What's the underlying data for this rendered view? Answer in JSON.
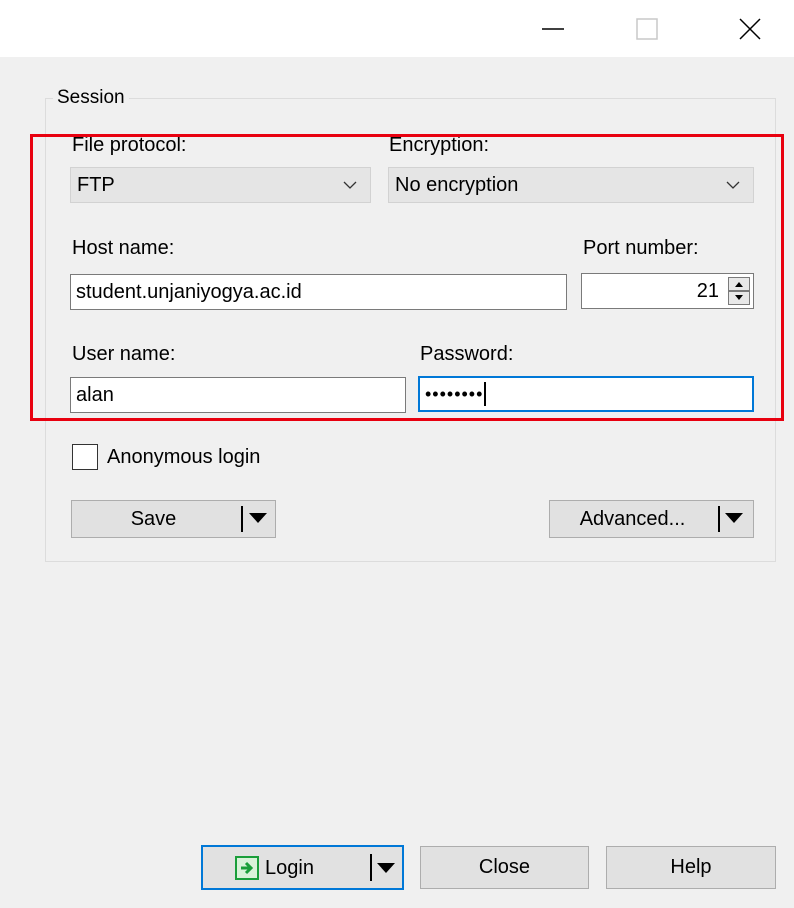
{
  "session": {
    "group_label": "Session",
    "file_protocol": {
      "label": "File protocol:",
      "value": "FTP"
    },
    "encryption": {
      "label": "Encryption:",
      "value": "No encryption"
    },
    "host": {
      "label": "Host name:",
      "value": "student.unjaniyogya.ac.id"
    },
    "port": {
      "label": "Port number:",
      "value": "21"
    },
    "user": {
      "label": "User name:",
      "value": "alan"
    },
    "password": {
      "label": "Password:",
      "value": "••••••••"
    },
    "anonymous": {
      "label": "Anonymous login",
      "checked": false
    },
    "save_label": "Save",
    "advanced_label": "Advanced..."
  },
  "footer": {
    "login_label": "Login",
    "close_label": "Close",
    "help_label": "Help"
  },
  "colors": {
    "highlight": "#e8000f",
    "focus": "#0078d7",
    "login_icon": "#1a9e3a"
  },
  "icons": [
    "minimize-icon",
    "maximize-icon",
    "close-window-icon",
    "chevron-down-icon",
    "dropdown-arrow-icon",
    "login-icon"
  ]
}
